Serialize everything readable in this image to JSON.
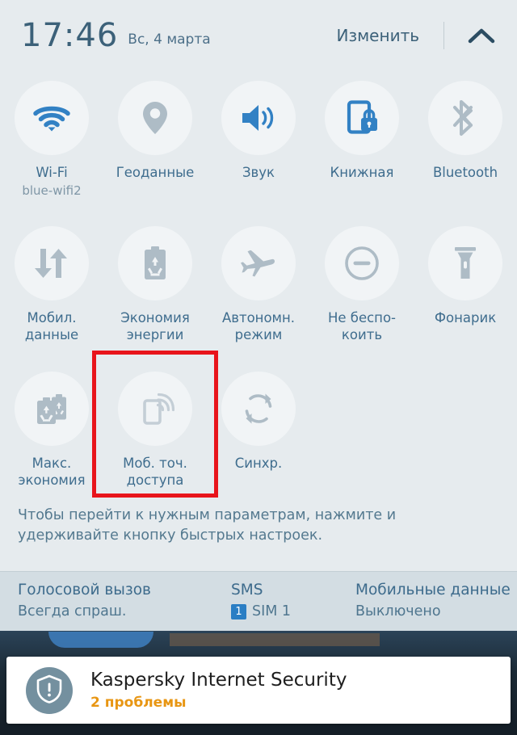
{
  "header": {
    "clock": "17:46",
    "date": "Вс, 4 марта",
    "edit_label": "Изменить",
    "collapse_icon": "chevron-up-icon"
  },
  "colors": {
    "panel_bg": "#e6ebee",
    "tile_circle": "#f1f4f6",
    "active_icon": "#3281c4",
    "inactive_icon": "#aebcc6",
    "label_text": "#3f6d8e",
    "highlight_border": "#e8141b",
    "sim_bar_bg": "#d3dde3",
    "warning_text": "#e89613"
  },
  "quick_settings": {
    "rows": [
      [
        {
          "label": "Wi-Fi",
          "sub": "blue-wifi2",
          "icon": "wifi-icon",
          "active": true
        },
        {
          "label": "Геоданные",
          "sub": "",
          "icon": "location-pin-icon",
          "active": false
        },
        {
          "label": "Звук",
          "sub": "",
          "icon": "volume-icon",
          "active": true
        },
        {
          "label": "Книжная",
          "sub": "",
          "icon": "portrait-lock-icon",
          "active": true
        },
        {
          "label": "Bluetooth",
          "sub": "",
          "icon": "bluetooth-icon",
          "active": false
        }
      ],
      [
        {
          "label": "Мобил.\nданные",
          "sub": "",
          "icon": "mobile-data-icon",
          "active": false
        },
        {
          "label": "Экономия\nэнергии",
          "sub": "",
          "icon": "battery-saver-icon",
          "active": false
        },
        {
          "label": "Автономн.\nрежим",
          "sub": "",
          "icon": "airplane-icon",
          "active": false
        },
        {
          "label": "Не беспо-\nкоить",
          "sub": "",
          "icon": "do-not-disturb-icon",
          "active": false
        },
        {
          "label": "Фонарик",
          "sub": "",
          "icon": "flashlight-icon",
          "active": false
        }
      ],
      [
        {
          "label": "Макс.\nэкономия",
          "sub": "",
          "icon": "max-battery-saver-icon",
          "active": false
        },
        {
          "label": "Моб. точ.\nдоступа",
          "sub": "",
          "icon": "mobile-hotspot-icon",
          "active": false
        },
        {
          "label": "Синхр.",
          "sub": "",
          "icon": "sync-icon",
          "active": false
        }
      ]
    ]
  },
  "hint": "Чтобы перейти к нужным параметрам, нажмите и удерживайте кнопку быстрых настроек.",
  "sim_bar": {
    "voice_title": "Голосовой вызов",
    "voice_value": "Всегда спраш.",
    "sms_title": "SMS",
    "sms_badge": "1",
    "sms_value": "SIM 1",
    "data_title": "Мобильные данные",
    "data_value": "Выключено"
  },
  "notification": {
    "icon": "shield-alert-icon",
    "title": "Kaspersky Internet Security",
    "subtitle": "2 проблемы"
  }
}
